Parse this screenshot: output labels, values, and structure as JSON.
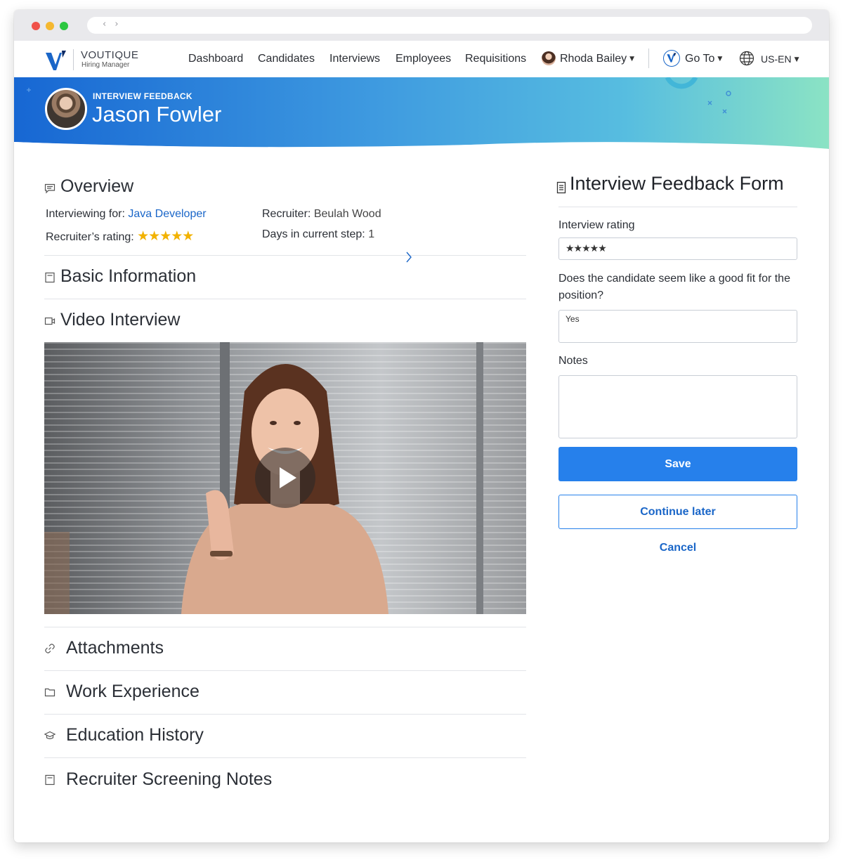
{
  "browser": {
    "nav_glyph": "‹ ›"
  },
  "brand": {
    "name": "VOUTIQUE",
    "subtitle": "Hiring Manager"
  },
  "nav": {
    "links": [
      "Dashboard",
      "Candidates",
      "Interviews",
      "Employees",
      "Requisitions"
    ],
    "user_name": "Rhoda Bailey",
    "goto_label": "Go To",
    "locale": "US-EN"
  },
  "hero": {
    "kicker": "INTERVIEW FEEDBACK",
    "candidate_name": "Jason Fowler"
  },
  "overview": {
    "title": "Overview",
    "interviewing_for_label": "Interviewing for:",
    "interviewing_for_value": "Java Developer",
    "recruiter_label": "Recruiter:",
    "recruiter_value": "Beulah Wood",
    "recruiter_rating_label": "Recruiter’s rating:",
    "recruiter_rating_stars": "★★★★★",
    "recruiter_rating_value": 5,
    "days_label": "Days in current step:",
    "days_value": "1"
  },
  "sections": {
    "basic_information": "Basic Information",
    "video_interview": "Video Interview",
    "attachments": "Attachments",
    "work_experience": "Work Experience",
    "education_history": "Education History",
    "screening_notes": "Recruiter Screening Notes"
  },
  "form": {
    "title": "Interview Feedback Form",
    "rating_label": "Interview rating",
    "rating_stars": "★★★★★",
    "rating_value": 5,
    "fit_question": "Does the candidate seem like a good fit for the position?",
    "fit_answer": "Yes",
    "notes_label": "Notes",
    "notes_value": "",
    "save_label": "Save",
    "continue_label": "Continue later",
    "cancel_label": "Cancel"
  },
  "colors": {
    "accent": "#2680eb",
    "link": "#1a66c8",
    "star": "#f2b200"
  }
}
